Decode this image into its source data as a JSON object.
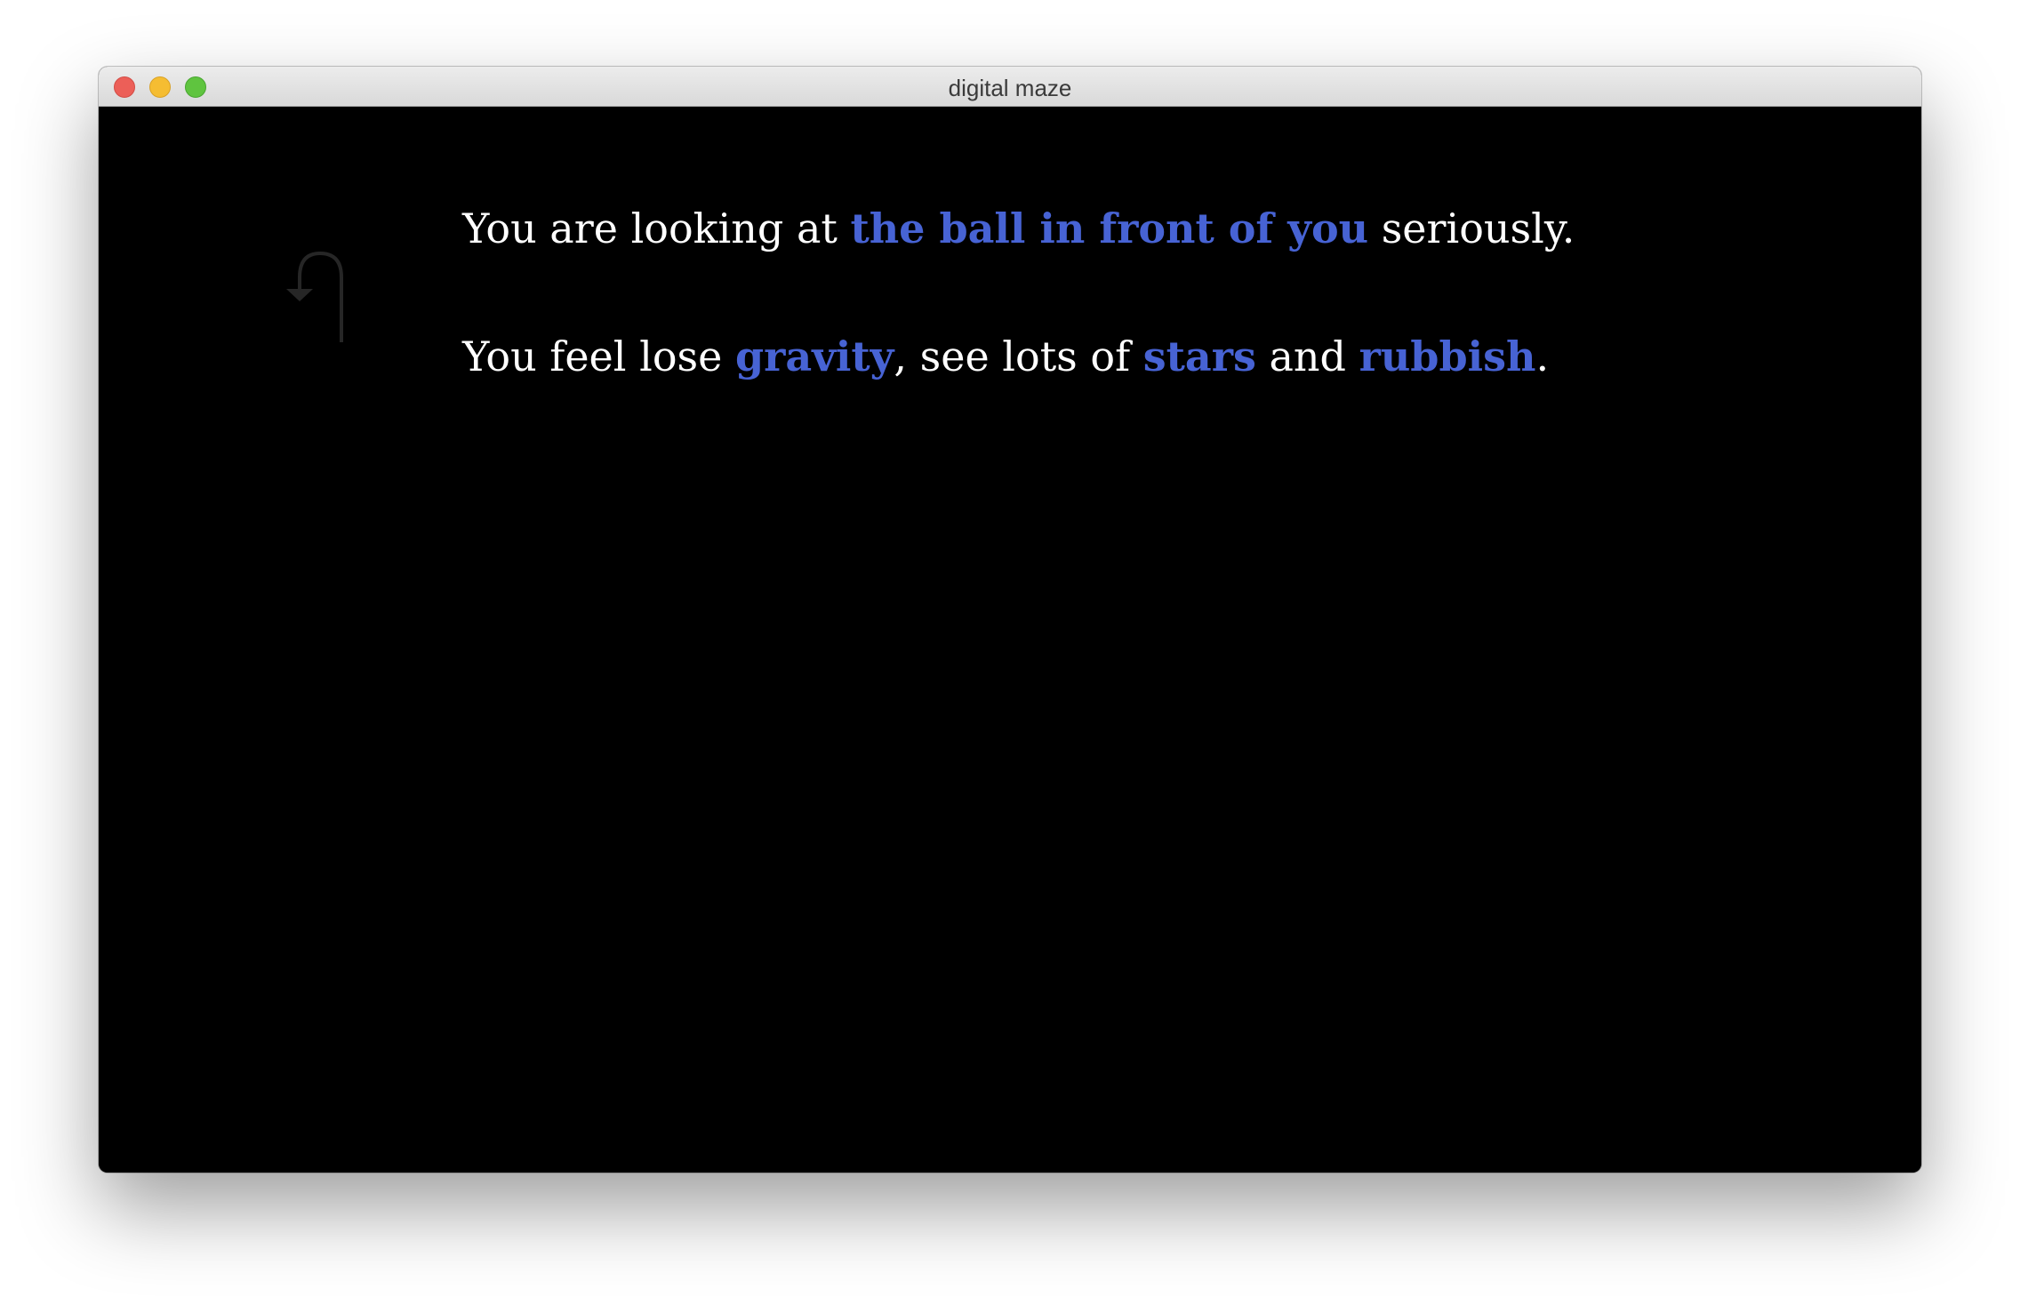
{
  "window": {
    "title": "digital maze"
  },
  "icons": {
    "back": "return-arrow-icon"
  },
  "colors": {
    "background": "#000000",
    "text": "#ffffff",
    "link": "#4763d4",
    "icon": "#262626"
  },
  "story": {
    "line1": {
      "before": "You are looking at ",
      "link": "the ball in front of you",
      "after": " seriously."
    },
    "line2": {
      "before": "You feel lose ",
      "link1": "gravity",
      "mid1": ", see lots of ",
      "link2": "stars",
      "mid2": " and ",
      "link3": "rubbish",
      "after": "."
    }
  }
}
